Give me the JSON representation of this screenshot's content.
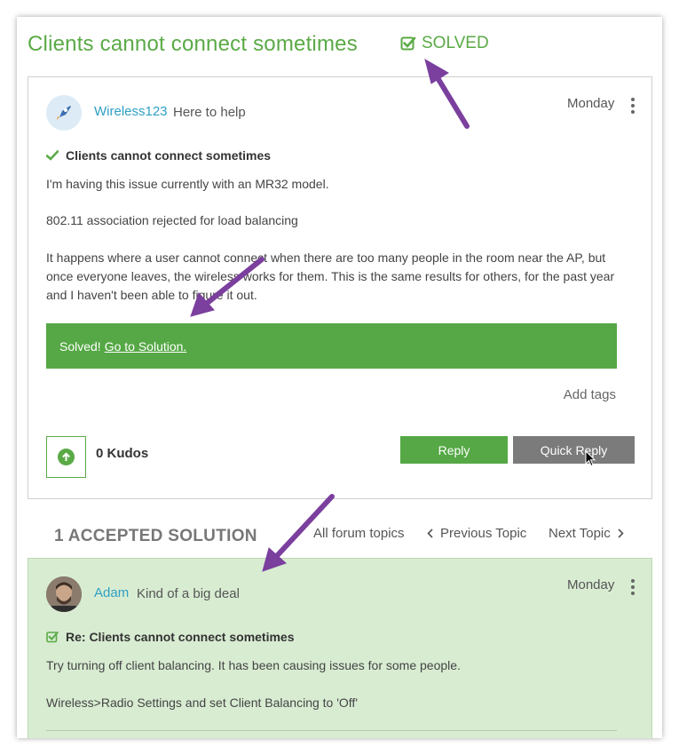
{
  "topic": {
    "title": "Clients cannot connect sometimes",
    "status_label": "SOLVED"
  },
  "post": {
    "author": "Wireless123",
    "rank": "Here to help",
    "date": "Monday",
    "subject": "Clients cannot connect sometimes",
    "paragraphs": [
      "I'm having this issue currently with an MR32 model.",
      "802.11 association rejected for load balancing",
      "It happens where a user cannot connect when there are too many people in the room near the AP, but once everyone leaves, the wireless works for them.  This is the same results for others, for the past year and I haven't been able to figure it out."
    ],
    "solution_bar": {
      "prefix": "Solved!",
      "link": "Go to Solution."
    },
    "add_tags": "Add tags",
    "kudos": "0 Kudos",
    "reply_label": "Reply",
    "quick_reply_label": "Quick Reply"
  },
  "accepted": {
    "heading": "1 ACCEPTED SOLUTION",
    "nav": {
      "all_topics": "All forum topics",
      "previous": "Previous Topic",
      "next": "Next Topic"
    }
  },
  "solution": {
    "author": "Adam",
    "rank": "Kind of a big deal",
    "date": "Monday",
    "subject": "Re: Clients cannot connect sometimes",
    "paragraphs": [
      "Try turning off client balancing.  It has been causing issues for some people.",
      "Wireless>Radio Settings and set Client Balancing to 'Off'"
    ]
  },
  "colors": {
    "accent_green": "#5aaa46",
    "link_blue": "#2f9fc4",
    "annotation_purple": "#7b3f9e",
    "solution_background": "#d8ecd2"
  },
  "icons": [
    "checkbox-check-icon",
    "check-icon",
    "rocket-avatar",
    "kebab-menu-icon",
    "arrow-up-circle-icon",
    "chevron-left-icon",
    "chevron-right-icon",
    "mouse-cursor-icon"
  ]
}
